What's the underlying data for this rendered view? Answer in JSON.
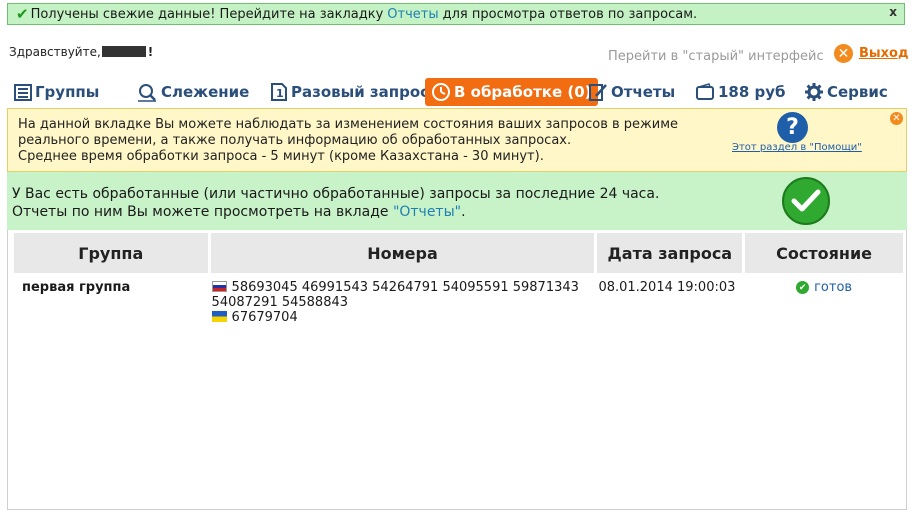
{
  "notification": {
    "prefix": "Получены свежие данные! Перейдите на закладку",
    "link": "Отчеты",
    "suffix": "для просмотра ответов по запросам.",
    "close": "x"
  },
  "header": {
    "greeting": "Здравствуйте,",
    "greeting_end": "!",
    "old_ui": "Перейти в \"старый\" интерфейс",
    "logout": "Выход"
  },
  "tabs": [
    {
      "label": "Группы",
      "icon": "list-icon"
    },
    {
      "label": "Слежение",
      "icon": "monitor-icon"
    },
    {
      "label": "Разовый запрос",
      "icon": "single-request-icon"
    },
    {
      "label": "В обработке (0)",
      "icon": "clock-icon",
      "active": true
    },
    {
      "label": "Отчеты",
      "icon": "report-icon"
    },
    {
      "label": "188 руб",
      "icon": "wallet-icon"
    },
    {
      "label": "Сервис",
      "icon": "gear-icon"
    }
  ],
  "info": {
    "line1": "На данной вкладке Вы можете наблюдать за изменением состояния ваших запросов в режиме",
    "line2": "реального времени, а также получать информацию об обработанных запросах.",
    "line3": "Среднее время обработки запроса - 5 минут (кроме Казахстана - 30 минут).",
    "help_symbol": "?",
    "help_link": "Этот раздел в \"Помощи\""
  },
  "success": {
    "line1": "У Вас есть обработанные (или частично обработанные) запросы за последние 24 часа.",
    "line2_prefix": "Отчеты по ним Вы можете просмотреть на вкладе",
    "line2_link": "\"Отчеты\"",
    "line2_suffix": "."
  },
  "table": {
    "headers": [
      "Группа",
      "Номера",
      "Дата запроса",
      "Состояние"
    ],
    "rows": [
      {
        "group": "первая группа",
        "numbers_ru_line1": "58693045 46991543 54264791 54095591 59871343",
        "numbers_ru_line2": "54087291 54588843",
        "numbers_ua": "67679704",
        "date": "08.01.2014 19:00:03",
        "status": "готов"
      }
    ]
  },
  "colors": {
    "accent": "#f26c12",
    "tab_text": "#2a4f7a",
    "link": "#1f7fb2",
    "success_bg": "#c8f2c8",
    "info_bg": "#fff7c8"
  }
}
